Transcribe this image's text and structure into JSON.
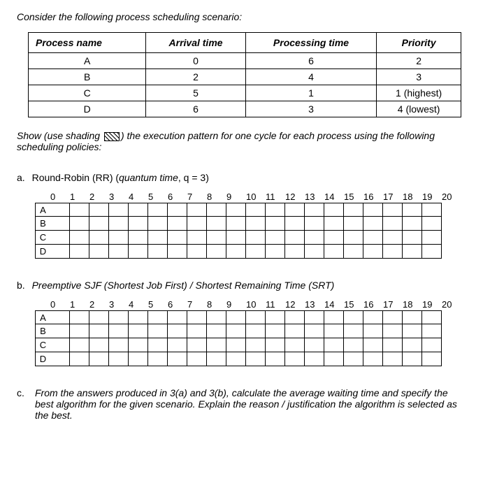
{
  "intro": "Consider the following process scheduling scenario:",
  "table": {
    "headers": [
      "Process name",
      "Arrival time",
      "Processing time",
      "Priority"
    ],
    "rows": [
      {
        "name": "A",
        "arrival": "0",
        "processing": "6",
        "priority": "2"
      },
      {
        "name": "B",
        "arrival": "2",
        "processing": "4",
        "priority": "3"
      },
      {
        "name": "C",
        "arrival": "5",
        "processing": "1",
        "priority": "1 (highest)"
      },
      {
        "name": "D",
        "arrival": "6",
        "processing": "3",
        "priority": "4 (lowest)"
      }
    ]
  },
  "show_text_pre": "Show (use shading ",
  "show_text_post": ") the execution pattern for one cycle for each process using the following scheduling policies:",
  "section_a": {
    "marker": "a.",
    "title_prefix": "Round-Robin (RR) (",
    "title_italic": "quantum time",
    "title_suffix": ", q = 3)"
  },
  "section_b": {
    "marker": "b.",
    "title": "Preemptive SJF (Shortest Job First) / Shortest Remaining Time (SRT)"
  },
  "section_c": {
    "marker": "c.",
    "text": "From the answers produced in 3(a) and 3(b), calculate the average waiting time and specify the best algorithm for the given scenario. Explain the reason / justification the algorithm is selected as the best."
  },
  "chart_data": [
    {
      "type": "table",
      "title": "Round-Robin Gantt (empty)",
      "time_labels": [
        "0",
        "1",
        "2",
        "3",
        "4",
        "5",
        "6",
        "7",
        "8",
        "9",
        "10",
        "11",
        "12",
        "13",
        "14",
        "15",
        "16",
        "17",
        "18",
        "19",
        "20"
      ],
      "rows": [
        "A",
        "B",
        "C",
        "D"
      ],
      "cells_per_row": 20,
      "shaded": []
    },
    {
      "type": "table",
      "title": "SRT Gantt (empty)",
      "time_labels": [
        "0",
        "1",
        "2",
        "3",
        "4",
        "5",
        "6",
        "7",
        "8",
        "9",
        "10",
        "11",
        "12",
        "13",
        "14",
        "15",
        "16",
        "17",
        "18",
        "19",
        "20"
      ],
      "rows": [
        "A",
        "B",
        "C",
        "D"
      ],
      "cells_per_row": 20,
      "shaded": []
    }
  ]
}
